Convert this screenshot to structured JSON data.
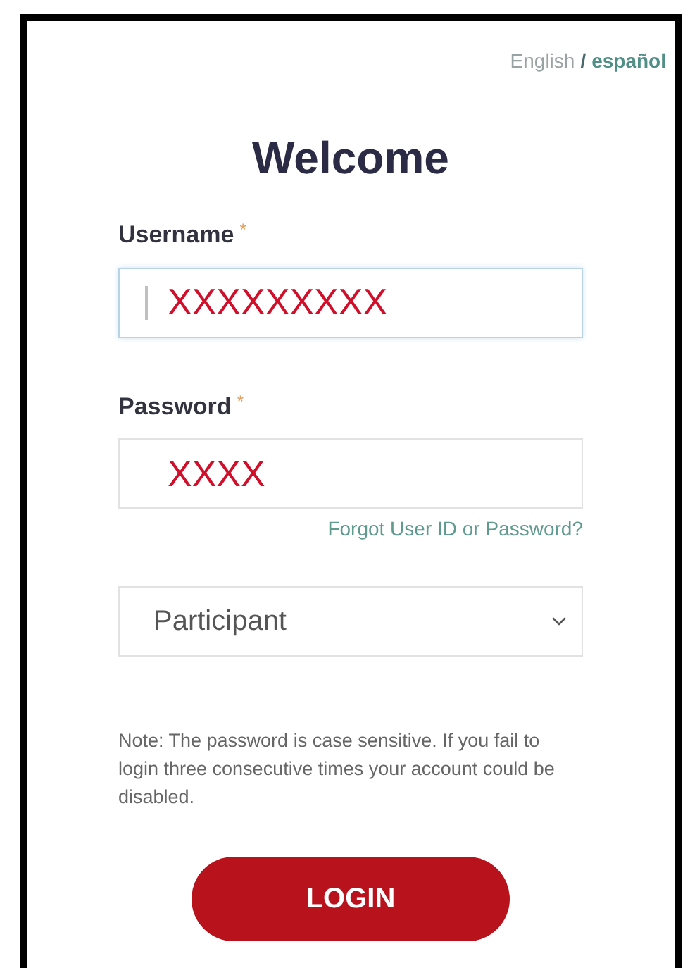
{
  "languages": [
    {
      "label": "English",
      "selected": true
    },
    {
      "label": "español",
      "selected": false
    }
  ],
  "language_separator": "/",
  "title": "Welcome",
  "fields": [
    {
      "label": "Username",
      "required_mark": "*",
      "value": "XXXXXXXXX",
      "focused": true
    },
    {
      "label": "Password",
      "required_mark": "*",
      "value": "XXXX",
      "focused": false
    }
  ],
  "forgot_link": "Forgot User ID or Password?",
  "role_select": {
    "value": "Participant"
  },
  "note": "Note: The password is case sensitive. If you fail to login three consecutive times your account could be disabled.",
  "login_button": "LOGIN"
}
